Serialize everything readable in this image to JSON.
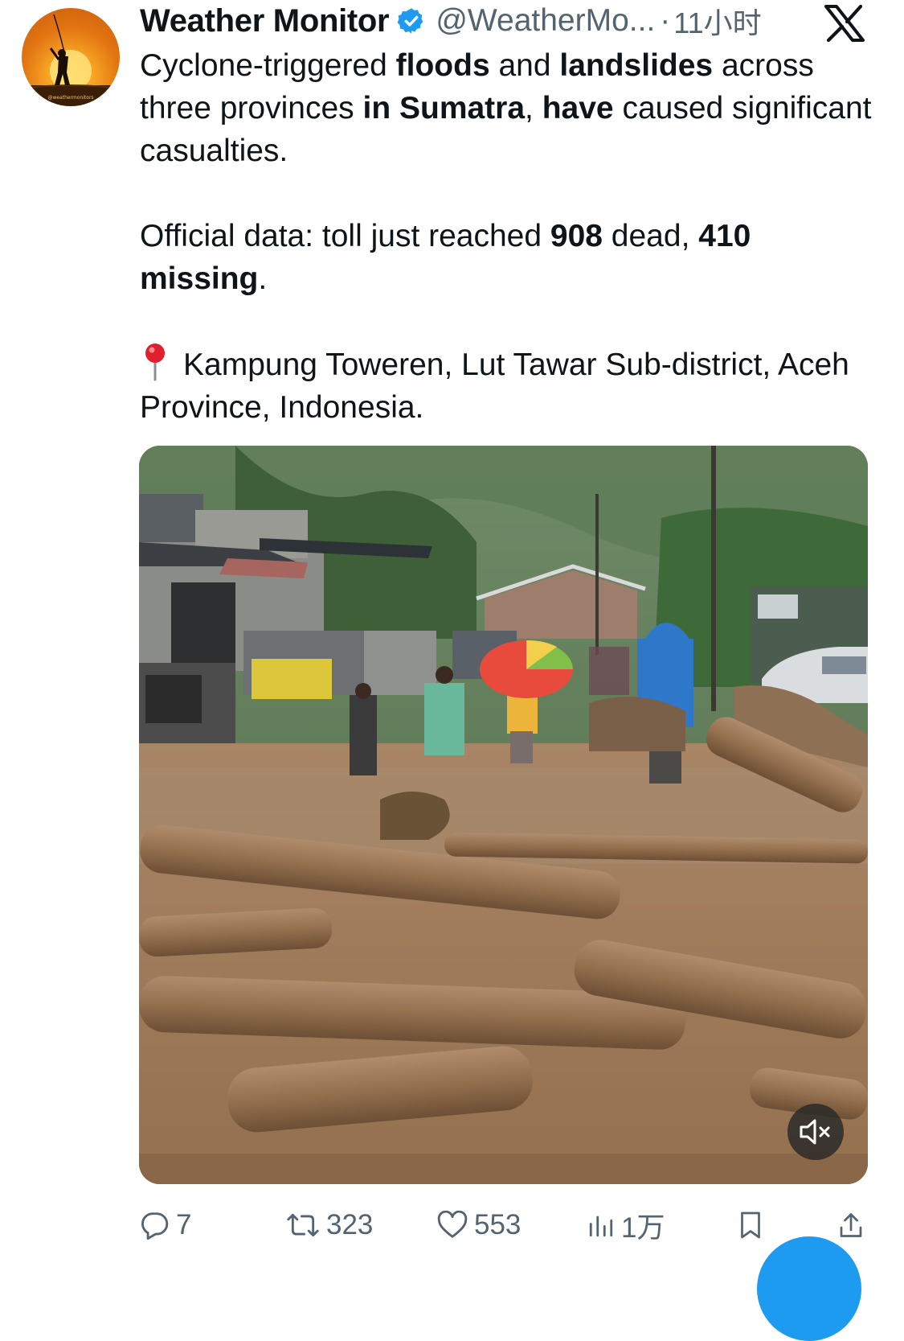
{
  "author": {
    "name": "Weather Monitor",
    "handle": "@WeatherMo...",
    "separator": "·",
    "time": "11小时",
    "avatar_caption": "@weathermonitors",
    "verified": true
  },
  "tweet": {
    "p1": {
      "s1": "Cyclone-triggered ",
      "b1": "floods",
      "s2": " and ",
      "b2": "landslides",
      "s3": " across three provinces ",
      "b3": "in Sumatra",
      "s4": ", ",
      "b4": "have",
      "s5": " caused significant casualties."
    },
    "p2": {
      "s1": "Official data: toll just reached ",
      "b1": "908",
      "s2": " dead, ",
      "b2": "410 missing",
      "s3": "."
    },
    "p3": {
      "pin_icon": "round-pushpin-icon",
      "text": "Kampung Toweren, Lut Tawar Sub-district, Aceh Province, Indonesia."
    }
  },
  "media": {
    "type": "video",
    "mute_icon": "speaker-muted-icon"
  },
  "actions": {
    "replies": "7",
    "reposts": "323",
    "likes": "553",
    "views": "1万"
  },
  "colors": {
    "text": "#0f1419",
    "secondary": "#536471",
    "verified": "#1d9bf0",
    "accent": "#1d9bf0"
  }
}
